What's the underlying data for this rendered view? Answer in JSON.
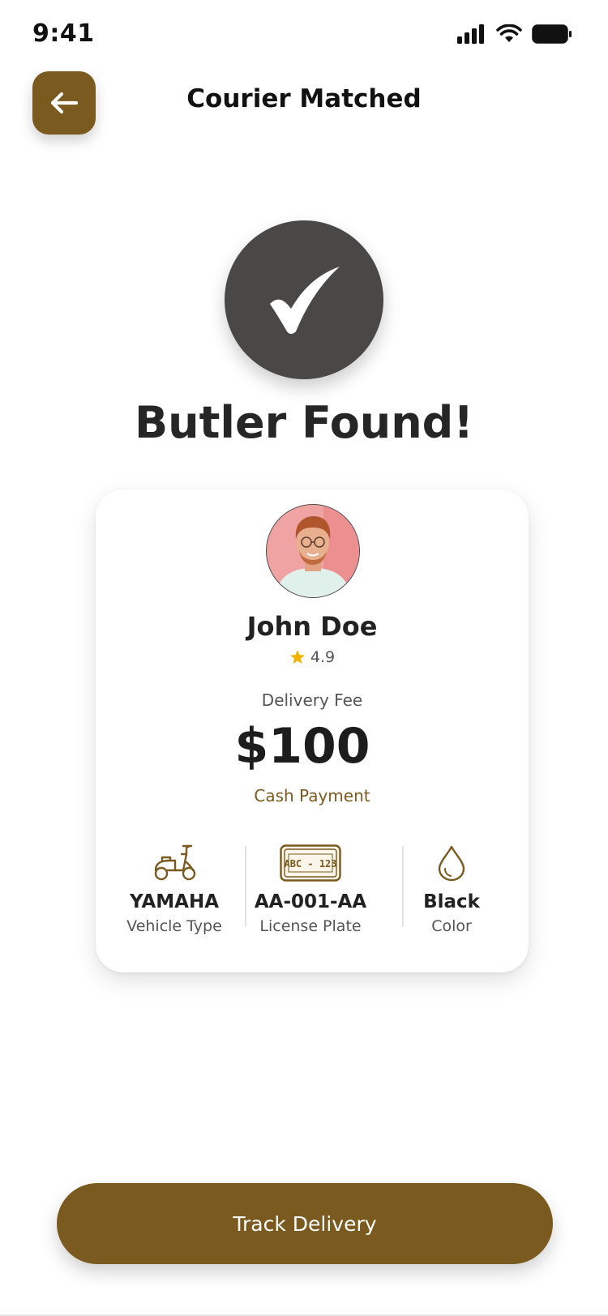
{
  "status_bar": {
    "time": "9:41"
  },
  "header": {
    "title": "Courier Matched",
    "back_icon": "arrow-left-icon"
  },
  "success": {
    "icon": "checkmark-icon",
    "title": "Butler Found!"
  },
  "courier": {
    "name": "John Doe",
    "rating": "4.9",
    "rating_icon": "star-icon",
    "avatar": "courier-avatar-photo"
  },
  "fee": {
    "label": "Delivery Fee",
    "amount": "$100",
    "payment_method": "Cash Payment"
  },
  "details": [
    {
      "icon": "scooter-icon",
      "value": "YAMAHA",
      "label": "Vehicle Type"
    },
    {
      "icon": "license-plate-icon",
      "value": "AA-001-AA",
      "label": "License Plate",
      "plate_text": "ABC - 123"
    },
    {
      "icon": "droplet-icon",
      "value": "Black",
      "label": "Color"
    }
  ],
  "actions": {
    "track_label": "Track Delivery"
  },
  "colors": {
    "accent": "#7a5a1e",
    "success_circle": "#4a4846",
    "star": "#f5b301",
    "text_primary": "#222222",
    "text_secondary": "#555555"
  }
}
